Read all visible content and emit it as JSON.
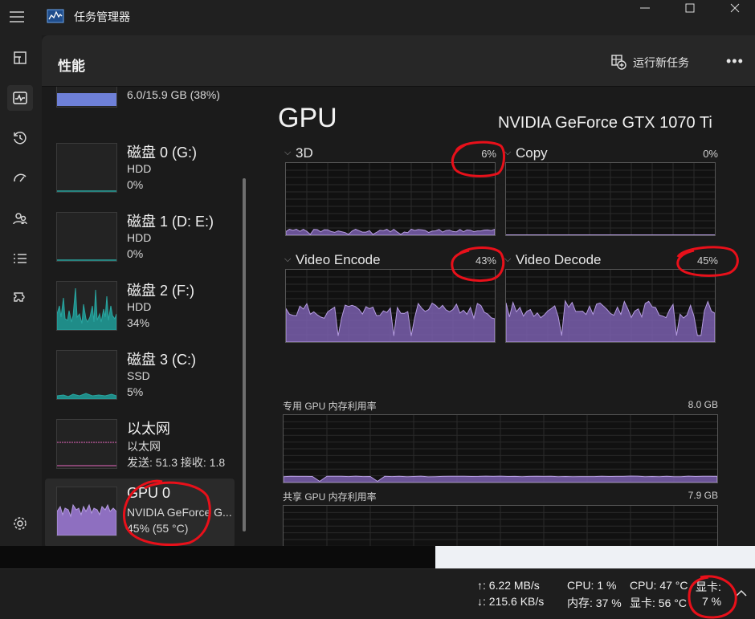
{
  "window": {
    "title": "任务管理器"
  },
  "header": {
    "title": "性能",
    "run_task": "运行新任务"
  },
  "sidebar": {
    "memory_value": "6.0/15.9 GB (38%)",
    "items": [
      {
        "name": "磁盘 0 (G:)",
        "sub": "HDD",
        "value": "0%"
      },
      {
        "name": "磁盘 1 (D: E:)",
        "sub": "HDD",
        "value": "0%"
      },
      {
        "name": "磁盘 2 (F:)",
        "sub": "HDD",
        "value": "34%"
      },
      {
        "name": "磁盘 3 (C:)",
        "sub": "SSD",
        "value": "5%"
      },
      {
        "name": "以太网",
        "sub": "以太网",
        "value": "发送: 51.3 接收: 1.8"
      },
      {
        "name": "GPU 0",
        "sub": "NVIDIA GeForce G...",
        "value": "45% (55 °C)"
      }
    ]
  },
  "gpu": {
    "title": "GPU",
    "model": "NVIDIA GeForce GTX 1070 Ti",
    "engines": [
      {
        "label": "3D",
        "value": "6%",
        "level": 0.06
      },
      {
        "label": "Copy",
        "value": "0%",
        "level": 0.0
      },
      {
        "label": "Video Encode",
        "value": "43%",
        "level": 0.43
      },
      {
        "label": "Video Decode",
        "value": "45%",
        "level": 0.45
      }
    ],
    "dedicated_label": "专用 GPU 内存利用率",
    "dedicated_value": "8.0 GB",
    "shared_label": "共享 GPU 内存利用率",
    "shared_value": "7.9 GB"
  },
  "taskbar": {
    "up": "↑: 6.22 MB/s",
    "down": "↓: 215.6 KB/s",
    "cpu": "CPU: 1 %",
    "mem": "内存: 37 %",
    "cpu_temp": "CPU: 47 °C",
    "gpu_temp": "显卡: 56 °C",
    "gpu_label": "显卡:",
    "gpu_usage": "7 %"
  },
  "colors": {
    "accent_purple": "#9b7fc8",
    "disk_teal": "#2aa5a0",
    "memory_blue": "#6e80d8",
    "annotation_red": "#e8101a"
  },
  "icons": [
    "hamburger-icon",
    "app-logo-icon",
    "processes-icon",
    "performance-icon",
    "history-icon",
    "startup-icon",
    "users-icon",
    "details-icon",
    "services-icon",
    "settings-icon",
    "run-task-icon",
    "more-icon"
  ]
}
